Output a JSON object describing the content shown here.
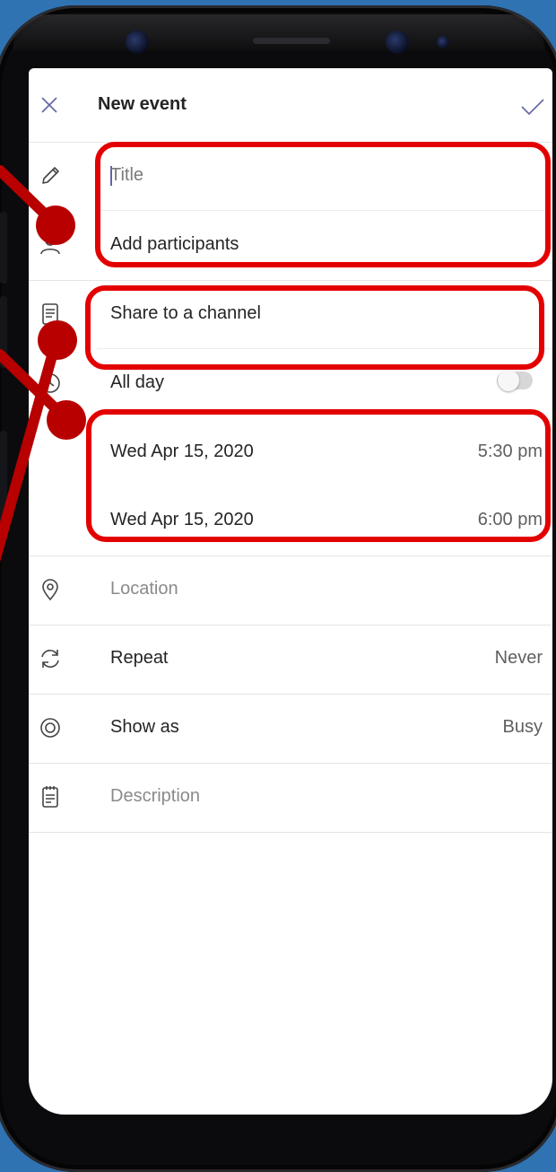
{
  "header": {
    "title": "New event",
    "close_icon": "close-icon",
    "confirm_icon": "checkmark-icon"
  },
  "form": {
    "title_placeholder": "Title",
    "participants_placeholder": "Add participants",
    "channel_label": "Share to a channel",
    "all_day_label": "All day",
    "all_day_enabled": false,
    "start_date": "Wed Apr 15, 2020",
    "start_time": "5:30 pm",
    "end_date": "Wed Apr 15, 2020",
    "end_time": "6:00 pm",
    "location_placeholder": "Location",
    "repeat_label": "Repeat",
    "repeat_value": "Never",
    "show_as_label": "Show as",
    "show_as_value": "Busy",
    "description_placeholder": "Description"
  },
  "icons": [
    "pencil-icon",
    "participants-icon",
    "channel-icon",
    "clock-icon",
    "location-pin-icon",
    "repeat-icon",
    "show-as-icon",
    "description-icon"
  ],
  "colors": {
    "accent": "#6264a7",
    "annotation": "#e30000",
    "background": "#2f73b3"
  }
}
